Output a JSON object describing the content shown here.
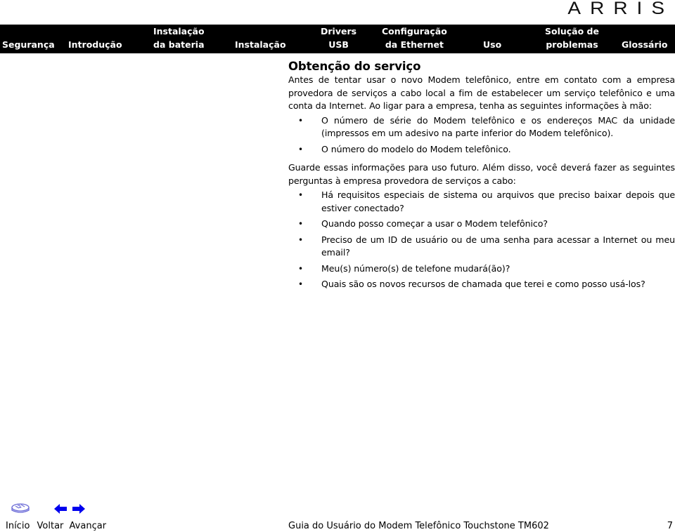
{
  "header": {
    "logo_text": "ARRIS"
  },
  "nav": {
    "items": [
      {
        "line1": "",
        "line2": "Segurança"
      },
      {
        "line1": "",
        "line2": "Introdução"
      },
      {
        "line1": "Instalação",
        "line2": "da bateria"
      },
      {
        "line1": "",
        "line2": "Instalação"
      },
      {
        "line1": "Drivers",
        "line2": "USB"
      },
      {
        "line1": "Configuração",
        "line2": "da Ethernet"
      },
      {
        "line1": "",
        "line2": "Uso"
      },
      {
        "line1": "Solução de",
        "line2": "problemas"
      },
      {
        "line1": "",
        "line2": "Glossário"
      }
    ]
  },
  "content": {
    "title": "Obtenção do serviço",
    "intro": "Antes de tentar usar o novo Modem telefônico, entre em contato com a empresa provedora de serviços a cabo local a fim de estabelecer um serviço telefônico e uma conta da Internet. Ao ligar para a empresa, tenha as seguintes informações à mão:",
    "info_bullets": [
      "O número de série do Modem telefônico e os endereços MAC da unidade (impressos em um adesivo na parte inferior do Modem telefônico).",
      "O número do modelo do Modem telefônico."
    ],
    "middle": "Guarde essas informações para uso futuro. Além disso, você deverá fazer as seguintes perguntas à empresa provedora de serviços a cabo:",
    "question_bullets": [
      "Há requisitos especiais de sistema ou arquivos que preciso baixar depois que estiver conectado?",
      "Quando posso começar a usar o Modem telefônico?",
      "Preciso de um ID de usuário ou de uma senha para acessar a Internet ou meu email?",
      "Meu(s) número(s) de telefone mudará(ão)?",
      "Quais são os novos recursos de chamada que terei e como posso usá-los?"
    ],
    "bullet_glyph": "•"
  },
  "footer": {
    "icons": {
      "home": "home-icon",
      "back": "arrow-left-icon",
      "forward": "arrow-right-icon"
    },
    "icon_color": "#0000ee",
    "home_icon_color": "#6b6bd6",
    "links": {
      "home": "Início",
      "back": "Voltar",
      "forward": "Avançar"
    },
    "doc_title": "Guia do Usuário do Modem Telefônico Touchstone TM602",
    "page_number": "7"
  }
}
